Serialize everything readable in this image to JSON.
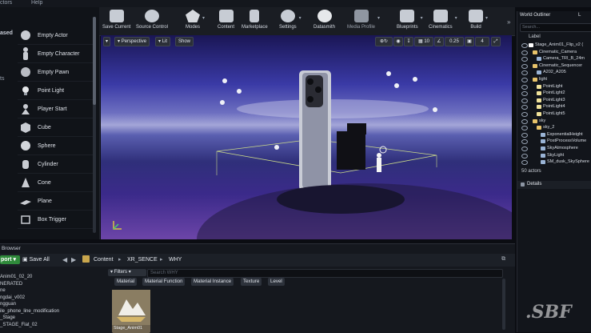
{
  "menubar": {
    "items": [
      "ctors",
      "Help"
    ]
  },
  "modes": {
    "tab_label": "ased",
    "side_label": "ts",
    "actors": [
      "Empty Actor",
      "Empty Character",
      "Empty Pawn",
      "Point Light",
      "Player Start",
      "Cube",
      "Sphere",
      "Cylinder",
      "Cone",
      "Plane",
      "Box Trigger"
    ]
  },
  "toolbar": {
    "items": [
      "Save Current",
      "Source Control",
      "Modes",
      "Content",
      "Marketplace",
      "Settings",
      "Datasmith",
      "Media Profile",
      "Blueprints",
      "Cinematics",
      "Build"
    ]
  },
  "viewport": {
    "perspective": "Perspective",
    "lit": "Lit",
    "show": "Show",
    "snap_angle": "0.25",
    "cam_speed": "4"
  },
  "outliner": {
    "title": "World Outliner",
    "title2": "L",
    "search_placeholder": "Search...",
    "column_label": "Label",
    "rows": [
      {
        "label": "Stage_Anim01_Flip_v2 (",
        "indent": 0,
        "color": "#ffffff"
      },
      {
        "label": "Cinematic_Camera",
        "indent": 1,
        "color": "#e8c36a"
      },
      {
        "label": "Camera_TRI_B_24m",
        "indent": 2,
        "color": "#9ab4d6"
      },
      {
        "label": "Cinematic_Sequencer",
        "indent": 1,
        "color": "#e8c36a"
      },
      {
        "label": "A202_A205",
        "indent": 2,
        "color": "#9ab4d6"
      },
      {
        "label": "light",
        "indent": 1,
        "color": "#e8c36a"
      },
      {
        "label": "PointLight",
        "indent": 2,
        "color": "#f0e29a"
      },
      {
        "label": "PointLight2",
        "indent": 2,
        "color": "#f0e29a"
      },
      {
        "label": "PointLight3",
        "indent": 2,
        "color": "#f0e29a"
      },
      {
        "label": "PointLight4",
        "indent": 2,
        "color": "#f0e29a"
      },
      {
        "label": "PointLight5",
        "indent": 2,
        "color": "#f0e29a"
      },
      {
        "label": "sky",
        "indent": 1,
        "color": "#e8c36a"
      },
      {
        "label": "sky_2",
        "indent": 2,
        "color": "#e8c36a"
      },
      {
        "label": "ExponentialHeight",
        "indent": 3,
        "color": "#9ab4d6"
      },
      {
        "label": "PostProcessVolume",
        "indent": 3,
        "color": "#9ab4d6"
      },
      {
        "label": "SkyAtmosphere",
        "indent": 3,
        "color": "#9ab4d6"
      },
      {
        "label": "SkyLight",
        "indent": 3,
        "color": "#9ab4d6"
      },
      {
        "label": "SM_dusk_SkySphere",
        "indent": 3,
        "color": "#9ab4d6"
      }
    ],
    "actor_count": "50 actors",
    "details_title": "Details"
  },
  "content_browser": {
    "tab": "Browser",
    "import_label": "port",
    "save_all": "Save All",
    "crumbs": [
      "Content",
      "XR_SENCE",
      "WHY"
    ],
    "search_placeholder": "Search WHY",
    "filters": "Filters",
    "filter_tabs": [
      "Material",
      "Material Function",
      "Material Instance",
      "Texture",
      "Level"
    ],
    "tree": [
      "Anim01_02_20",
      "NERATED",
      "ne",
      "ngdai_v002",
      "ngguan",
      "ile_phone_line_modification",
      "_Stage",
      "_STAGE_Flat_02"
    ],
    "asset_label": "Stage_Anim01"
  },
  "watermark": ".SBF"
}
